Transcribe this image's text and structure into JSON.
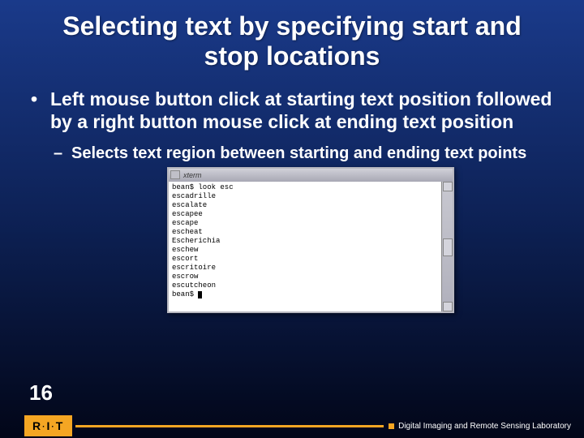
{
  "title": "Selecting text by specifying start and stop locations",
  "bullet": {
    "mark": "•",
    "text": "Left mouse button click at starting text position followed by a right button mouse click at ending text position"
  },
  "sub": {
    "mark": "–",
    "text": "Selects text region between starting and ending text points"
  },
  "xterm": {
    "title": "xterm",
    "lines": [
      "bean$ look esc",
      "escadrille",
      "escalate",
      "escapee",
      "escape",
      "escheat",
      "Escherichia",
      "eschew",
      "escort",
      "escritoire",
      "escrow",
      "escutcheon",
      "bean$ "
    ]
  },
  "page": "16",
  "footer": {
    "rit": [
      "R",
      "I",
      "T"
    ],
    "lab": "Digital Imaging and Remote Sensing Laboratory"
  }
}
